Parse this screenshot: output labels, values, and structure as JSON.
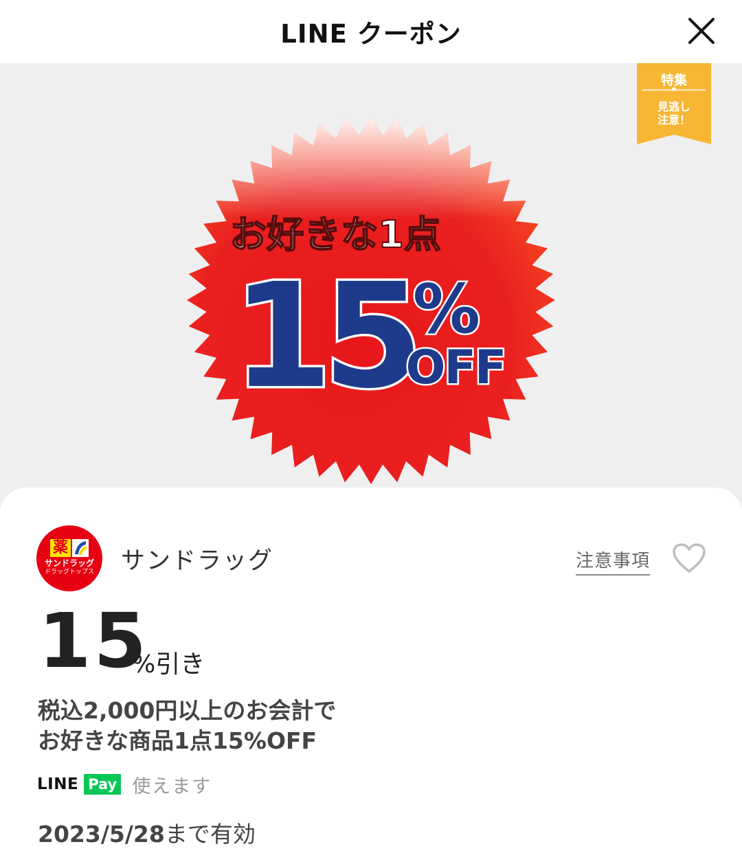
{
  "header": {
    "title": "LINE クーポン"
  },
  "banner": {
    "headline": "お好きな1点",
    "percent": "15",
    "percent_sign": "%",
    "off": "OFF",
    "ribbon_top": "特集",
    "ribbon_star": "★",
    "ribbon_line1": "見逃し",
    "ribbon_line2": "注意！",
    "colors": {
      "burst_red": "#e8171b",
      "number_blue": "#1e3a8a",
      "ribbon_yellow": "#f7b634",
      "background": "#efefef"
    }
  },
  "card": {
    "logo": {
      "kanji": "薬",
      "name": "サンドラッグ",
      "sub": "ドラッグトップス",
      "color": "#e60012"
    },
    "store_name": "サンドラッグ",
    "notes_label": "注意事項",
    "discount_value": "15",
    "discount_unit": "%引き",
    "description_line1": "税込2,000円以上のお会計で",
    "description_line2": "お好きな商品1点15%OFF",
    "pay": {
      "line": "LINE",
      "badge": "Pay",
      "usable": "使えます"
    },
    "validity_date": "2023/5/28",
    "validity_suffix": "まで有効"
  }
}
